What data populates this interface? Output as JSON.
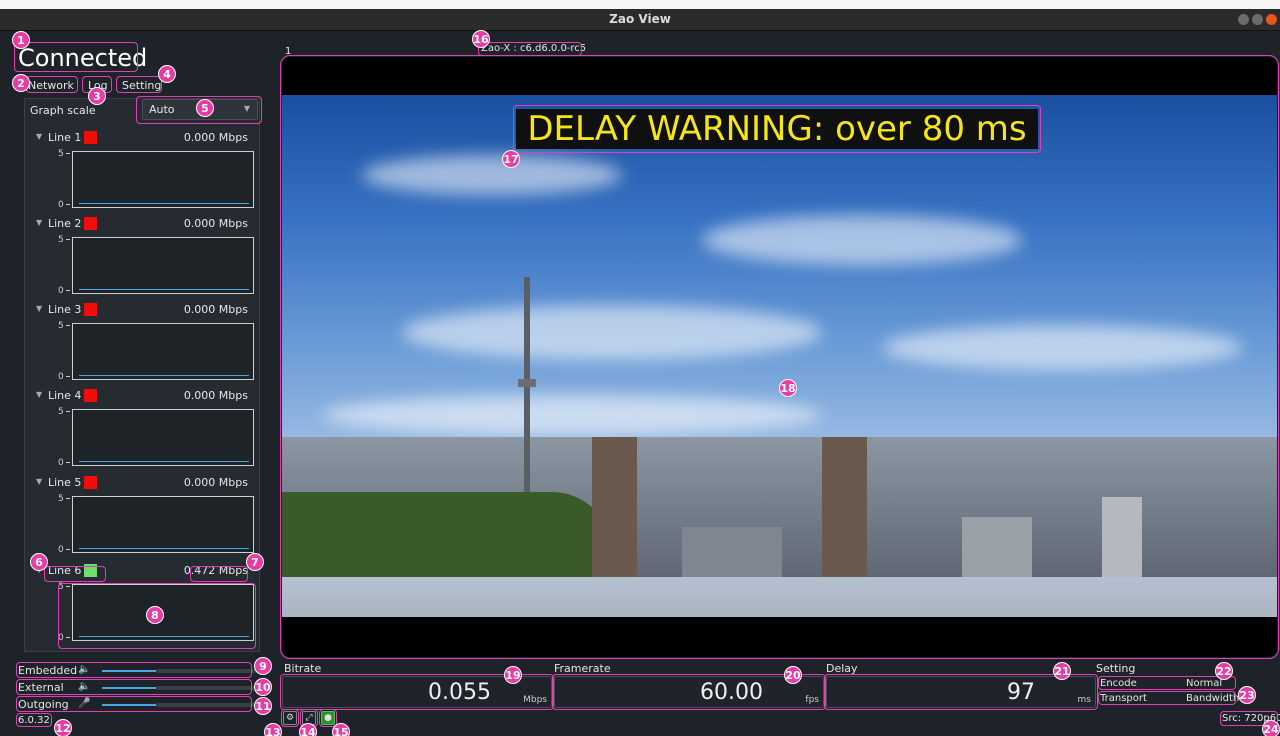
{
  "window": {
    "title": "Zao View"
  },
  "status": {
    "connection": "Connected"
  },
  "tabs": [
    {
      "label": "Network"
    },
    {
      "label": "Log"
    },
    {
      "label": "Setting"
    }
  ],
  "graph_scale": {
    "label": "Graph scale",
    "value": "Auto"
  },
  "lines": [
    {
      "name": "Line 1",
      "color": "#f20d0d",
      "rate": "0.000 Mbps",
      "y_max": "5",
      "y_min": "0"
    },
    {
      "name": "Line 2",
      "color": "#f20d0d",
      "rate": "0.000 Mbps",
      "y_max": "5",
      "y_min": "0"
    },
    {
      "name": "Line 3",
      "color": "#f20d0d",
      "rate": "0.000 Mbps",
      "y_max": "5",
      "y_min": "0"
    },
    {
      "name": "Line 4",
      "color": "#f20d0d",
      "rate": "0.000 Mbps",
      "y_max": "5",
      "y_min": "0"
    },
    {
      "name": "Line 5",
      "color": "#f20d0d",
      "rate": "0.000 Mbps",
      "y_max": "5",
      "y_min": "0"
    },
    {
      "name": "Line 6",
      "color": "#6fdc6f",
      "rate": "0.472 Mbps",
      "y_max": "5",
      "y_min": "0"
    }
  ],
  "audio": [
    {
      "label": "Embedded",
      "icon": "speaker-icon"
    },
    {
      "label": "External",
      "icon": "speaker-icon"
    },
    {
      "label": "Outgoing",
      "icon": "microphone-icon"
    }
  ],
  "version": "6.0.32.",
  "video": {
    "index": "1",
    "device": "Zao-X : c6.d6.0.0-rc5",
    "warning": "DELAY WARNING: over 80 ms"
  },
  "stats": {
    "bitrate": {
      "label": "Bitrate",
      "value": "0.055",
      "unit": "Mbps"
    },
    "framerate": {
      "label": "Framerate",
      "value": "60.00",
      "unit": "fps"
    },
    "delay": {
      "label": "Delay",
      "value": "97",
      "unit": "ms"
    }
  },
  "setting": {
    "label": "Setting",
    "encode": {
      "key": "Encode",
      "value": "Normal"
    },
    "transport": {
      "key": "Transport",
      "value": "Bandwidth"
    }
  },
  "source": "Src: 720p60",
  "markers": [
    "1",
    "2",
    "3",
    "4",
    "5",
    "6",
    "7",
    "8",
    "9",
    "10",
    "11",
    "12",
    "13",
    "14",
    "15",
    "16",
    "17",
    "18",
    "19",
    "20",
    "21",
    "22",
    "23",
    "24"
  ]
}
